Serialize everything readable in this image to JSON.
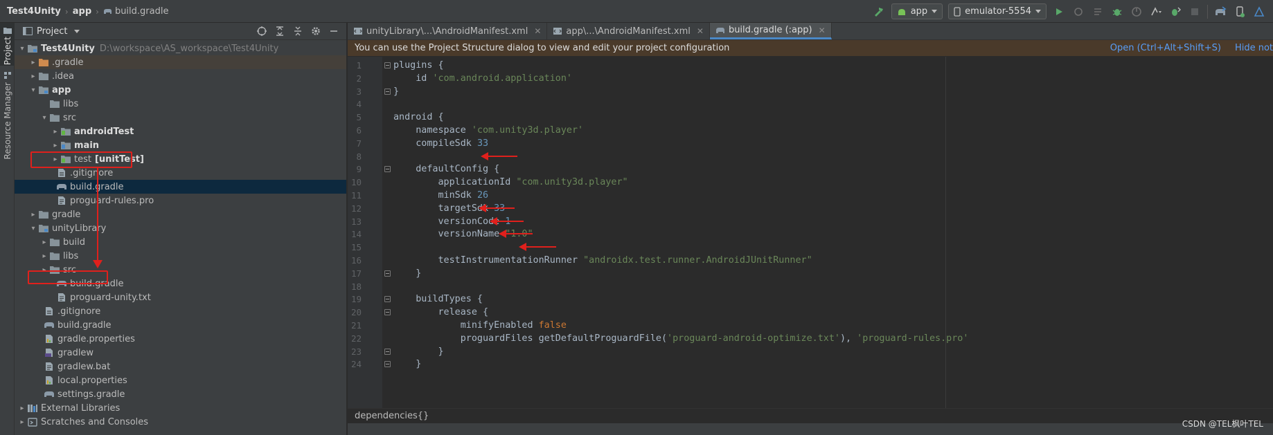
{
  "breadcrumb": {
    "project": "Test4Unity",
    "module": "app",
    "file": "build.gradle"
  },
  "toolbar": {
    "run_config": "app",
    "device": "emulator-5554"
  },
  "left_strip": {
    "project_tab": "Project",
    "resource_tab": "Resource Manager"
  },
  "project_panel": {
    "title": "Project",
    "tree": [
      {
        "label": "Test4Unity",
        "path": "D:\\workspace\\AS_workspace\\Test4Unity"
      },
      {
        "label": ".gradle"
      },
      {
        "label": ".idea"
      },
      {
        "label": "app"
      },
      {
        "label": "libs"
      },
      {
        "label": "src"
      },
      {
        "label": "androidTest"
      },
      {
        "label": "main"
      },
      {
        "label": "test",
        "suffix": "[unitTest]"
      },
      {
        "label": ".gitignore"
      },
      {
        "label": "build.gradle"
      },
      {
        "label": "proguard-rules.pro"
      },
      {
        "label": "gradle"
      },
      {
        "label": "unityLibrary"
      },
      {
        "label": "build"
      },
      {
        "label": "libs"
      },
      {
        "label": "src"
      },
      {
        "label": "build.gradle"
      },
      {
        "label": "proguard-unity.txt"
      },
      {
        "label": ".gitignore"
      },
      {
        "label": "build.gradle"
      },
      {
        "label": "gradle.properties"
      },
      {
        "label": "gradlew"
      },
      {
        "label": "gradlew.bat"
      },
      {
        "label": "local.properties"
      },
      {
        "label": "settings.gradle"
      },
      {
        "label": "External Libraries"
      },
      {
        "label": "Scratches and Consoles"
      }
    ]
  },
  "editor": {
    "tabs": [
      {
        "label": "unityLibrary\\...\\AndroidManifest.xml"
      },
      {
        "label": "app\\...\\AndroidManifest.xml"
      },
      {
        "label": "build.gradle (:app)"
      }
    ],
    "banner": {
      "text": "You can use the Project Structure dialog to view and edit your project configuration",
      "open_link": "Open (Ctrl+Alt+Shift+S)",
      "hide_link": "Hide not"
    },
    "code": [
      {
        "n": "1",
        "t": [
          [
            "plain",
            "plugins {"
          ]
        ]
      },
      {
        "n": "2",
        "t": [
          [
            "plain",
            "    id "
          ],
          [
            "str",
            "'com.android.application'"
          ]
        ]
      },
      {
        "n": "3",
        "t": [
          [
            "plain",
            "}"
          ]
        ]
      },
      {
        "n": "4",
        "t": [
          [
            "plain",
            ""
          ]
        ]
      },
      {
        "n": "5",
        "t": [
          [
            "plain",
            "android {"
          ]
        ]
      },
      {
        "n": "6",
        "t": [
          [
            "plain",
            "    namespace "
          ],
          [
            "str",
            "'com.unity3d.player'"
          ]
        ]
      },
      {
        "n": "7",
        "t": [
          [
            "plain",
            "    compileSdk "
          ],
          [
            "num",
            "33"
          ]
        ]
      },
      {
        "n": "8",
        "t": [
          [
            "plain",
            ""
          ]
        ]
      },
      {
        "n": "9",
        "t": [
          [
            "plain",
            "    defaultConfig {"
          ]
        ]
      },
      {
        "n": "10",
        "t": [
          [
            "plain",
            "        applicationId "
          ],
          [
            "str",
            "\"com.unity3d.player\""
          ]
        ]
      },
      {
        "n": "11",
        "t": [
          [
            "plain",
            "        minSdk "
          ],
          [
            "num",
            "26"
          ]
        ]
      },
      {
        "n": "12",
        "t": [
          [
            "plain",
            "        targetSdk "
          ],
          [
            "num",
            "33"
          ]
        ]
      },
      {
        "n": "13",
        "t": [
          [
            "plain",
            "        versionCode "
          ],
          [
            "num",
            "1"
          ]
        ]
      },
      {
        "n": "14",
        "t": [
          [
            "plain",
            "        versionName "
          ],
          [
            "str",
            "\"1.0\""
          ]
        ]
      },
      {
        "n": "15",
        "t": [
          [
            "plain",
            ""
          ]
        ]
      },
      {
        "n": "16",
        "t": [
          [
            "plain",
            "        testInstrumentationRunner "
          ],
          [
            "str",
            "\"androidx.test.runner.AndroidJUnitRunner\""
          ]
        ]
      },
      {
        "n": "17",
        "t": [
          [
            "plain",
            "    }"
          ]
        ]
      },
      {
        "n": "18",
        "t": [
          [
            "plain",
            ""
          ]
        ]
      },
      {
        "n": "19",
        "t": [
          [
            "plain",
            "    buildTypes {"
          ]
        ]
      },
      {
        "n": "20",
        "t": [
          [
            "plain",
            "        release {"
          ]
        ]
      },
      {
        "n": "21",
        "t": [
          [
            "plain",
            "            minifyEnabled "
          ],
          [
            "kw",
            "false"
          ]
        ]
      },
      {
        "n": "22",
        "t": [
          [
            "plain",
            "            proguardFiles getDefaultProguardFile("
          ],
          [
            "str",
            "'proguard-android-optimize.txt'"
          ],
          [
            "plain",
            "), "
          ],
          [
            "str",
            "'proguard-rules.pro'"
          ]
        ]
      },
      {
        "n": "23",
        "t": [
          [
            "plain",
            "        }"
          ]
        ]
      },
      {
        "n": "24",
        "t": [
          [
            "plain",
            "    }"
          ]
        ]
      }
    ],
    "bottom_breadcrumb": "dependencies{}"
  },
  "watermark": "CSDN @TEL枫叶TEL",
  "colors": {
    "highlight": "#e0201c",
    "selection": "#0d293e",
    "accent": "#4a88c7"
  }
}
